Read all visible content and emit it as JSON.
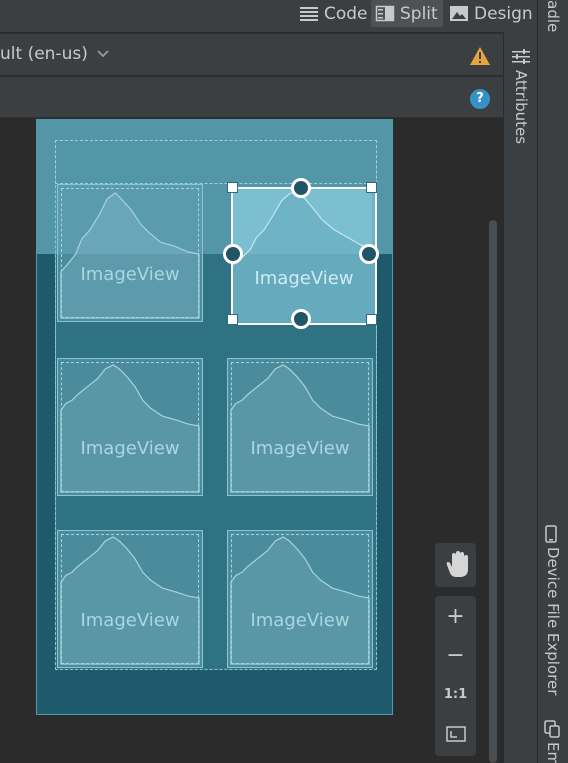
{
  "toolbar": {
    "code_label": "Code",
    "split_label": "Split",
    "design_label": "Design",
    "active_mode": "Split"
  },
  "config": {
    "locale_label": "ult (en-us)",
    "warning_icon": "warning-icon"
  },
  "subbar": {
    "help_glyph": "?"
  },
  "canvas": {
    "image_views": [
      {
        "label": "ImageView",
        "selected": false
      },
      {
        "label": "ImageView",
        "selected": true
      },
      {
        "label": "ImageView",
        "selected": false
      },
      {
        "label": "ImageView",
        "selected": false
      },
      {
        "label": "ImageView",
        "selected": false
      },
      {
        "label": "ImageView",
        "selected": false
      }
    ]
  },
  "zoom": {
    "pan_icon": "hand-icon",
    "zoom_in": "+",
    "zoom_out": "−",
    "actual_size": "1:1",
    "fit_icon": "fit-screen-icon"
  },
  "side_tools": {
    "attributes": "Attributes",
    "device_file_explorer": "Device File Explorer",
    "gradle_partial": "radle",
    "emulator_partial": "Em"
  },
  "colors": {
    "accent_selected": "#ffffff",
    "canvas_blue": "#1e5a6b",
    "warning": "#e8a33d",
    "help": "#3592c4"
  }
}
